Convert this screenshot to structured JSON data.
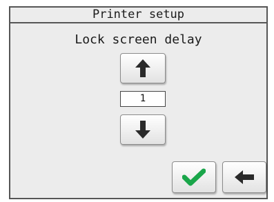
{
  "header": {
    "title": "Printer setup"
  },
  "setting": {
    "label": "Lock screen delay",
    "value": "1"
  },
  "icons": {
    "increase": "arrow-up-icon",
    "decrease": "arrow-down-icon",
    "confirm": "checkmark-icon",
    "back": "arrow-left-icon"
  },
  "colors": {
    "confirm_green": "#1aa64a",
    "arrow": "#2a2a2a"
  }
}
